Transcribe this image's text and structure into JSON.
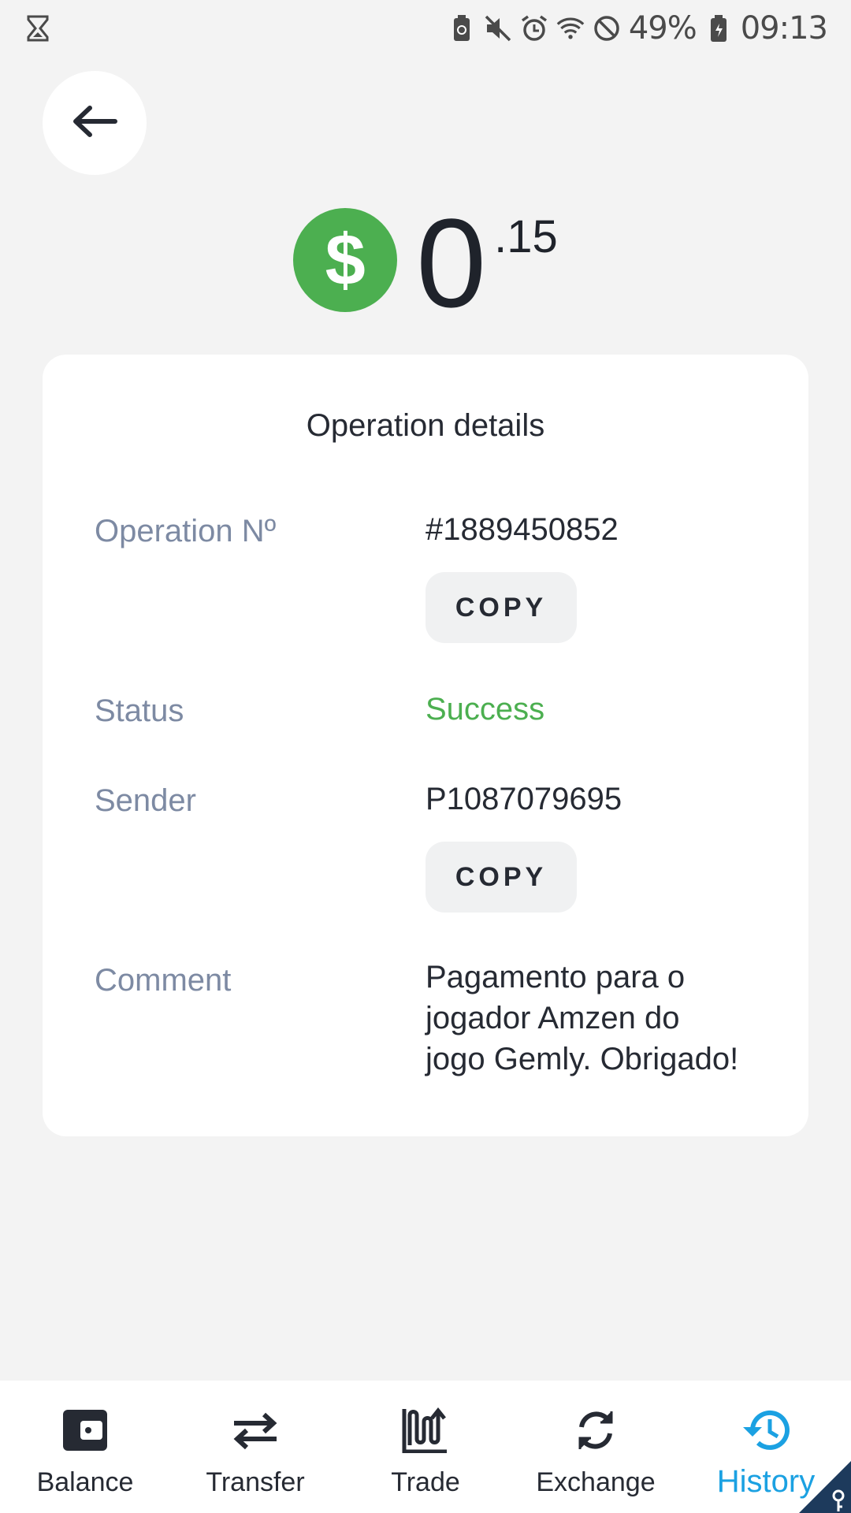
{
  "status_bar": {
    "battery_percent": "49%",
    "time": "09:13",
    "icons": [
      "hourglass-icon",
      "battery-saver-icon",
      "mute-icon",
      "alarm-icon",
      "wifi-icon",
      "do-not-disturb-icon",
      "battery-icon"
    ]
  },
  "amount": {
    "currency_symbol": "$",
    "integer": "0",
    "decimal": ".15",
    "badge_color": "#4caf50"
  },
  "details": {
    "title": "Operation details",
    "operation_label": "Operation Nº",
    "operation_value": "#1889450852",
    "copy_label": "COPY",
    "status_label": "Status",
    "status_value": "Success",
    "status_color": "#4caf50",
    "sender_label": "Sender",
    "sender_value": "P1087079695",
    "comment_label": "Comment",
    "comment_lines": [
      "Pagamento para o",
      "jogador Amzen do",
      "jogo Gemly. Obrigado!"
    ]
  },
  "nav": {
    "items": [
      {
        "label": "Balance",
        "icon": "wallet-icon"
      },
      {
        "label": "Transfer",
        "icon": "transfer-arrows-icon"
      },
      {
        "label": "Trade",
        "icon": "trade-icon"
      },
      {
        "label": "Exchange",
        "icon": "exchange-icon"
      },
      {
        "label": "History",
        "icon": "history-icon"
      }
    ],
    "active_index": 4,
    "active_color": "#1ba1e2"
  }
}
